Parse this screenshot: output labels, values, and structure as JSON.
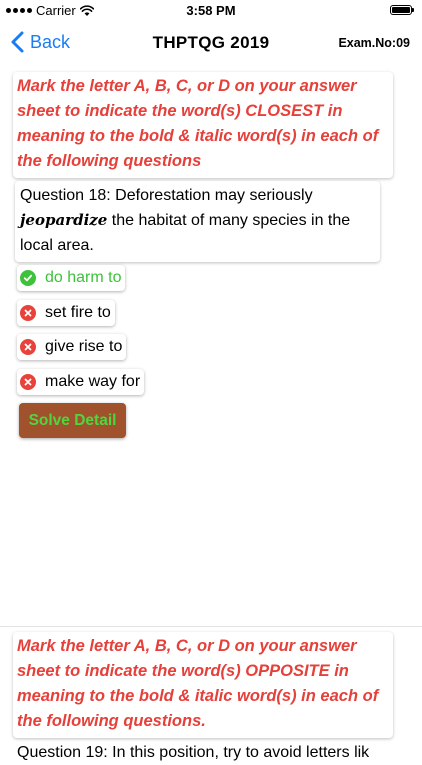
{
  "status_bar": {
    "carrier": "Carrier",
    "time": "3:58 PM"
  },
  "nav": {
    "back_label": "Back",
    "title": "THPTQG 2019",
    "exam_no": "Exam.No:09"
  },
  "section1": {
    "instruction": "Mark the letter A, B, C, or D on your answer sheet to indicate the word(s) CLOSEST in meaning to the bold & italic word(s) in each of the following questions",
    "question": {
      "prefix": "Question 18: Deforestation may seriously",
      "keyword": "jeopardize",
      "suffix": "the habitat of many species in the local area."
    },
    "answers": [
      {
        "text": "do harm to",
        "status": "correct"
      },
      {
        "text": "set fire to",
        "status": "wrong"
      },
      {
        "text": "give rise to",
        "status": "wrong"
      },
      {
        "text": "make way for",
        "status": "wrong"
      }
    ],
    "solve_label": "Solve Detail"
  },
  "section2": {
    "instruction": "Mark the letter A, B, C, or D on your answer sheet to indicate the word(s) OPPOSITE in meaning to the bold & italic word(s) in each of the following questions.",
    "question_preview": "Question 19: In this position, try to avoid letters lik"
  },
  "colors": {
    "accent": "#1a7cf5",
    "instruction": "#e6403a",
    "correct": "#3ec23b",
    "wrong": "#e8423a",
    "solve_bg": "#a0522d"
  },
  "icons": {
    "answer_correct": "check-circle-icon",
    "answer_wrong": "x-circle-icon"
  }
}
